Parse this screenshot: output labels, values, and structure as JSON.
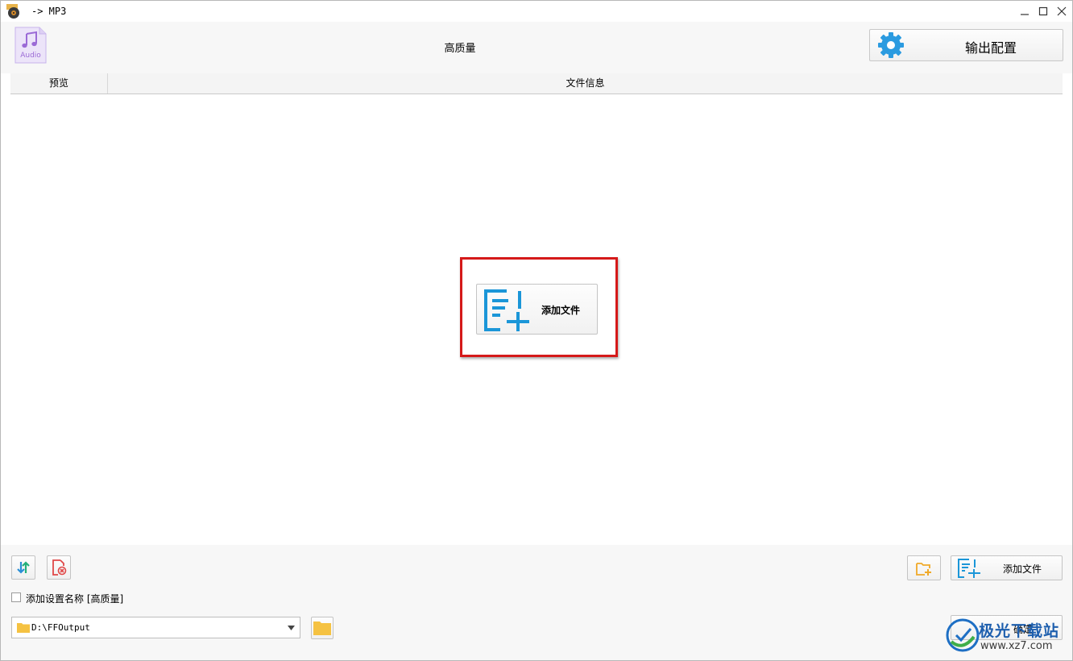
{
  "titlebar": {
    "title": "-> MP3",
    "minimize_icon": "minimize-icon",
    "maximize_icon": "maximize-icon",
    "close_icon": "close-icon"
  },
  "header": {
    "audio_icon_label": "Audio",
    "preset_name": "高质量",
    "output_config_label": "输出配置"
  },
  "file_list": {
    "columns": [
      "预览",
      "文件信息"
    ],
    "add_file_label": "添加文件"
  },
  "bottom": {
    "add_file_label": "添加文件",
    "add_preset_name_checkbox": {
      "label": "添加设置名称 [高质量]",
      "checked": false
    },
    "output_path": "D:\\FFOutput",
    "ok_label": "确定"
  },
  "watermark": {
    "text": "极光下载站",
    "url": "www.xz7.com"
  },
  "colors": {
    "accent_blue": "#1b96d8",
    "highlight_red": "#d51919",
    "folder_yellow": "#f5c242",
    "audio_purple": "#9b6ad6"
  }
}
